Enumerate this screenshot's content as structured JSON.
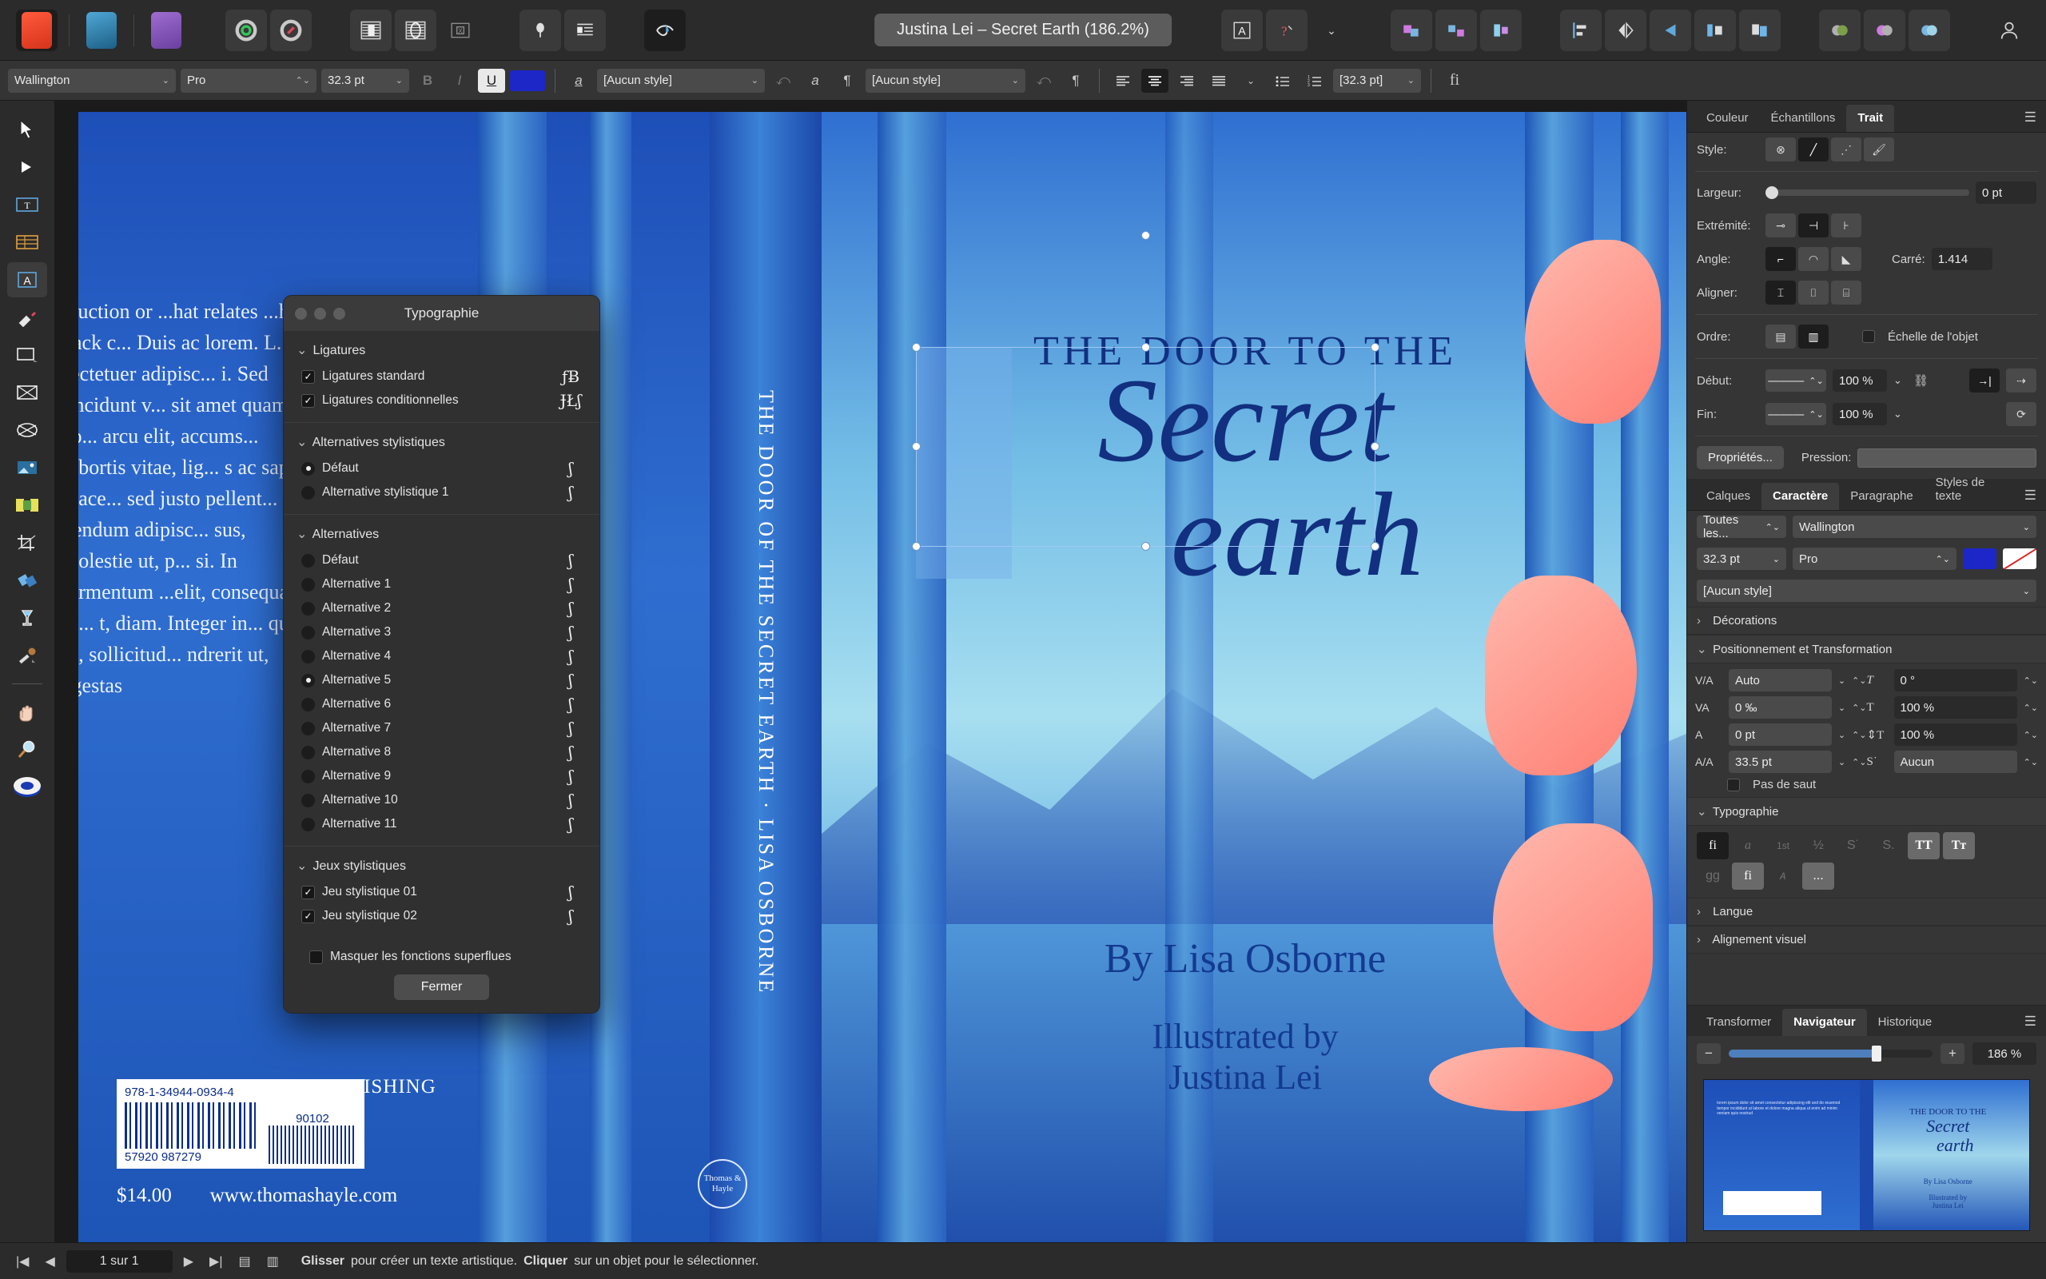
{
  "app": {
    "name": "Affinity Publisher",
    "document_title": "Justina Lei – Secret Earth (186.2%)"
  },
  "toolbar": {
    "apps": [
      {
        "name": "publisher-persona",
        "label": "Publisher"
      },
      {
        "name": "designer-persona",
        "label": "Designer"
      },
      {
        "name": "photo-persona",
        "label": "Photo"
      }
    ],
    "groups": [
      {
        "name": "preferences",
        "label": "Préférences"
      },
      {
        "name": "document-setup",
        "label": "Configuration du document"
      },
      {
        "name": "pages-panel",
        "label": "Pages"
      },
      {
        "name": "spread-panel",
        "label": "Planches"
      },
      {
        "name": "master-panel",
        "label": "Maquettes"
      },
      {
        "name": "pin-tool",
        "label": "Épingler"
      },
      {
        "name": "text-wrap",
        "label": "Habillage de texte"
      },
      {
        "name": "preview-mode",
        "label": "Aperçu"
      },
      {
        "name": "text-frame",
        "label": "Cadre de texte"
      },
      {
        "name": "spell-check",
        "label": "Orthographe"
      },
      {
        "name": "group",
        "label": "Grouper"
      },
      {
        "name": "ungroup",
        "label": "Dissocier"
      },
      {
        "name": "align-left",
        "label": "Aligner à gauche"
      },
      {
        "name": "flip-horizontal",
        "label": "Miroir horizontal"
      },
      {
        "name": "rotate-left",
        "label": "Rotation gauche"
      },
      {
        "name": "distribute",
        "label": "Distribuer"
      },
      {
        "name": "arrange",
        "label": "Disposer"
      },
      {
        "name": "boolean-add",
        "label": "Ajouter"
      },
      {
        "name": "boolean-subtract",
        "label": "Soustraire"
      },
      {
        "name": "boolean-intersect",
        "label": "Intersection"
      },
      {
        "name": "account",
        "label": "Compte"
      }
    ]
  },
  "context_bar": {
    "font_family": "Wallington",
    "font_style": "Pro",
    "font_size": "32.3 pt",
    "bold": "B",
    "italic": "I",
    "underline": "U",
    "text_color": "#1d27c7",
    "character_style": "[Aucun style]",
    "paragraph_style": "[Aucun style]",
    "leading": "[32.3 pt]",
    "ligature_btn": "fi",
    "align_options": [
      "Aligner à gauche",
      "Centrer",
      "Aligner à droite",
      "Justifier"
    ],
    "list_options": [
      "Liste à puces",
      "Liste numérotée"
    ]
  },
  "tools": [
    {
      "name": "move-tool",
      "label": "Déplacement"
    },
    {
      "name": "node-tool",
      "label": "Nœud"
    },
    {
      "name": "frame-text-tool",
      "label": "Outil Cadre de texte"
    },
    {
      "name": "table-tool",
      "label": "Tableau"
    },
    {
      "name": "artistic-text-tool",
      "label": "Texte artistique",
      "active": true
    },
    {
      "name": "pen-tool",
      "label": "Plume"
    },
    {
      "name": "rectangle-tool",
      "label": "Rectangle"
    },
    {
      "name": "picture-frame-rect-tool",
      "label": "Cadre d'image rectangulaire"
    },
    {
      "name": "picture-frame-ellipse-tool",
      "label": "Cadre d'image elliptique"
    },
    {
      "name": "place-image-tool",
      "label": "Placer une image"
    },
    {
      "name": "stock-panel-tool",
      "label": "Banque d'images"
    },
    {
      "name": "crop-tool",
      "label": "Recadrer"
    },
    {
      "name": "fill-tool",
      "label": "Remplissage"
    },
    {
      "name": "transparency-tool",
      "label": "Transparence"
    },
    {
      "name": "color-picker-tool",
      "label": "Pipette"
    },
    {
      "name": "view-tool",
      "label": "Main"
    },
    {
      "name": "zoom-tool",
      "label": "Zoom"
    },
    {
      "name": "color-wheel",
      "label": "Roue chromatique"
    }
  ],
  "typography_dialog": {
    "title": "Typographie",
    "groups": [
      {
        "name": "ligatures",
        "heading": "Ligatures",
        "items": [
          {
            "label": "Ligatures standard",
            "type": "checkbox",
            "checked": true,
            "glyph": "ƒɃ"
          },
          {
            "label": "Ligatures conditionnelles",
            "type": "checkbox",
            "checked": true,
            "glyph": "ɈŁʃ"
          }
        ]
      },
      {
        "name": "alternatives-stylistiques",
        "heading": "Alternatives stylistiques",
        "items": [
          {
            "label": "Défaut",
            "type": "radio",
            "checked": true,
            "glyph": "ʃ"
          },
          {
            "label": "Alternative stylistique 1",
            "type": "radio",
            "checked": false,
            "glyph": "ʃ"
          }
        ]
      },
      {
        "name": "alternatives",
        "heading": "Alternatives",
        "items": [
          {
            "label": "Défaut",
            "type": "radio",
            "checked": false,
            "glyph": "ʃ"
          },
          {
            "label": "Alternative 1",
            "type": "radio",
            "checked": false,
            "glyph": "ʃ"
          },
          {
            "label": "Alternative 2",
            "type": "radio",
            "checked": false,
            "glyph": "ʃ"
          },
          {
            "label": "Alternative 3",
            "type": "radio",
            "checked": false,
            "glyph": "ʃ"
          },
          {
            "label": "Alternative 4",
            "type": "radio",
            "checked": false,
            "glyph": "ʃ"
          },
          {
            "label": "Alternative 5",
            "type": "radio",
            "checked": true,
            "glyph": "ʃ"
          },
          {
            "label": "Alternative 6",
            "type": "radio",
            "checked": false,
            "glyph": "ʃ"
          },
          {
            "label": "Alternative 7",
            "type": "radio",
            "checked": false,
            "glyph": "ʃ"
          },
          {
            "label": "Alternative 8",
            "type": "radio",
            "checked": false,
            "glyph": "ʃ"
          },
          {
            "label": "Alternative 9",
            "type": "radio",
            "checked": false,
            "glyph": "ʃ"
          },
          {
            "label": "Alternative 10",
            "type": "radio",
            "checked": false,
            "glyph": "ʃ"
          },
          {
            "label": "Alternative 11",
            "type": "radio",
            "checked": false,
            "glyph": "ʃ"
          }
        ]
      },
      {
        "name": "jeux-stylistiques",
        "heading": "Jeux stylistiques",
        "items": [
          {
            "label": "Jeu stylistique 01",
            "type": "checkbox",
            "checked": true,
            "glyph": "ʃ"
          },
          {
            "label": "Jeu stylistique 02",
            "type": "checkbox",
            "checked": true,
            "glyph": "ʃ"
          }
        ]
      }
    ],
    "hide_superfluous": {
      "label": "Masquer les fonctions superflues",
      "checked": false
    },
    "close_button": "Fermer"
  },
  "right_panel": {
    "top_tabs": [
      {
        "label": "Couleur",
        "active": false
      },
      {
        "label": "Échantillons",
        "active": false
      },
      {
        "label": "Trait",
        "active": true
      }
    ],
    "stroke": {
      "style_label": "Style:",
      "style_options": [
        "Aucun",
        "Trait plein",
        "Pointillé",
        "Pinceau"
      ],
      "width_label": "Largeur:",
      "width_value": "0 pt",
      "cap_label": "Extrémité:",
      "join_label": "Angle:",
      "miter_label": "Carré:",
      "miter_value": "1.414",
      "align_label": "Aligner:",
      "order_label": "Ordre:",
      "object_scale_label": "Échelle de l'objet",
      "object_scale_checked": false,
      "start_label": "Début:",
      "start_scale": "100 %",
      "end_label": "Fin:",
      "end_scale": "100 %",
      "properties_button": "Propriétés...",
      "pressure_label": "Pression:"
    },
    "char_tabs": [
      {
        "label": "Calques",
        "active": false
      },
      {
        "label": "Caractère",
        "active": true
      },
      {
        "label": "Paragraphe",
        "active": false
      },
      {
        "label": "Styles de texte",
        "active": false
      }
    ],
    "character": {
      "font_filter": "Toutes les...",
      "font_family": "Wallington",
      "font_size": "32.3 pt",
      "font_style": "Pro",
      "text_style": "[Aucun style]",
      "fill_color": "#1d27c7",
      "stroke_color": "none",
      "decorations_label": "Décorations",
      "position_label": "Positionnement et Transformation",
      "kerning_label": "V/A",
      "kerning_value": "Auto",
      "tracking_label": "VA",
      "tracking_value": "0 ‰",
      "baseline_label": "A",
      "baseline_value": "0 pt",
      "leading_label": "A/A",
      "leading_value": "33.5 pt",
      "no_break_label": "Pas de saut",
      "no_break_checked": false,
      "skew_value": "0 °",
      "h_scale_value": "100 %",
      "v_scale_value": "100 %",
      "position_value": "Aucun",
      "typography_label": "Typographie",
      "typography_buttons": [
        "fi",
        "a",
        "1st",
        "½",
        "S˙",
        "S.",
        "TT",
        "Tᴛ",
        "gg",
        "fi",
        "ᴀ",
        "..."
      ],
      "language_label": "Langue",
      "optical_align_label": "Alignement visuel"
    },
    "bottom_tabs": [
      {
        "label": "Transformer",
        "active": false
      },
      {
        "label": "Navigateur",
        "active": true
      },
      {
        "label": "Historique",
        "active": false
      }
    ],
    "navigator": {
      "zoom_out": "−",
      "zoom_in": "+",
      "zoom_value": "186 %"
    }
  },
  "status_bar": {
    "page_indicator": "1 sur 1",
    "hint_bold_1": "Glisser",
    "hint_text_1": " pour créer un texte artistique. ",
    "hint_bold_2": "Cliquer",
    "hint_text_2": " sur un objet pour le sélectionner."
  },
  "document": {
    "spine_text": "THE DOOR OF THE SECRET EARTH · LISA OSBORNE",
    "cover": {
      "title_line1": "THE DOOR TO THE",
      "title_line2": "Secret",
      "title_line3": "earth",
      "author": "By Lisa Osborne",
      "illustrated_label": "Illustrated by",
      "illustrator": "Justina Lei",
      "publisher_mark": "Thomas & Hayle"
    },
    "back_cover": {
      "blurb": "...uction or ...hat relates ...he back c... Duis ac lorem. L... sectetuer adipisc... i. Sed tincidunt v... sit amet quam co... arcu elit, accums... lobortis vitae, lig... s ac sapien place... sed justo pellent... bendum adipisc... sus, molestie ut, p... si. In fermentum ...elit, consequat in... t, diam. Integer in... quat in, sollicitud... ndrerit ut, egestas",
      "publisher": "THOMAS & HAYLE PUBLISHING",
      "isbn": "978-1-34944-0934-4",
      "barcode_digits": "57920  987279",
      "addon": "90102",
      "price": "$14.00",
      "website": "www.thomashayle.com"
    }
  }
}
